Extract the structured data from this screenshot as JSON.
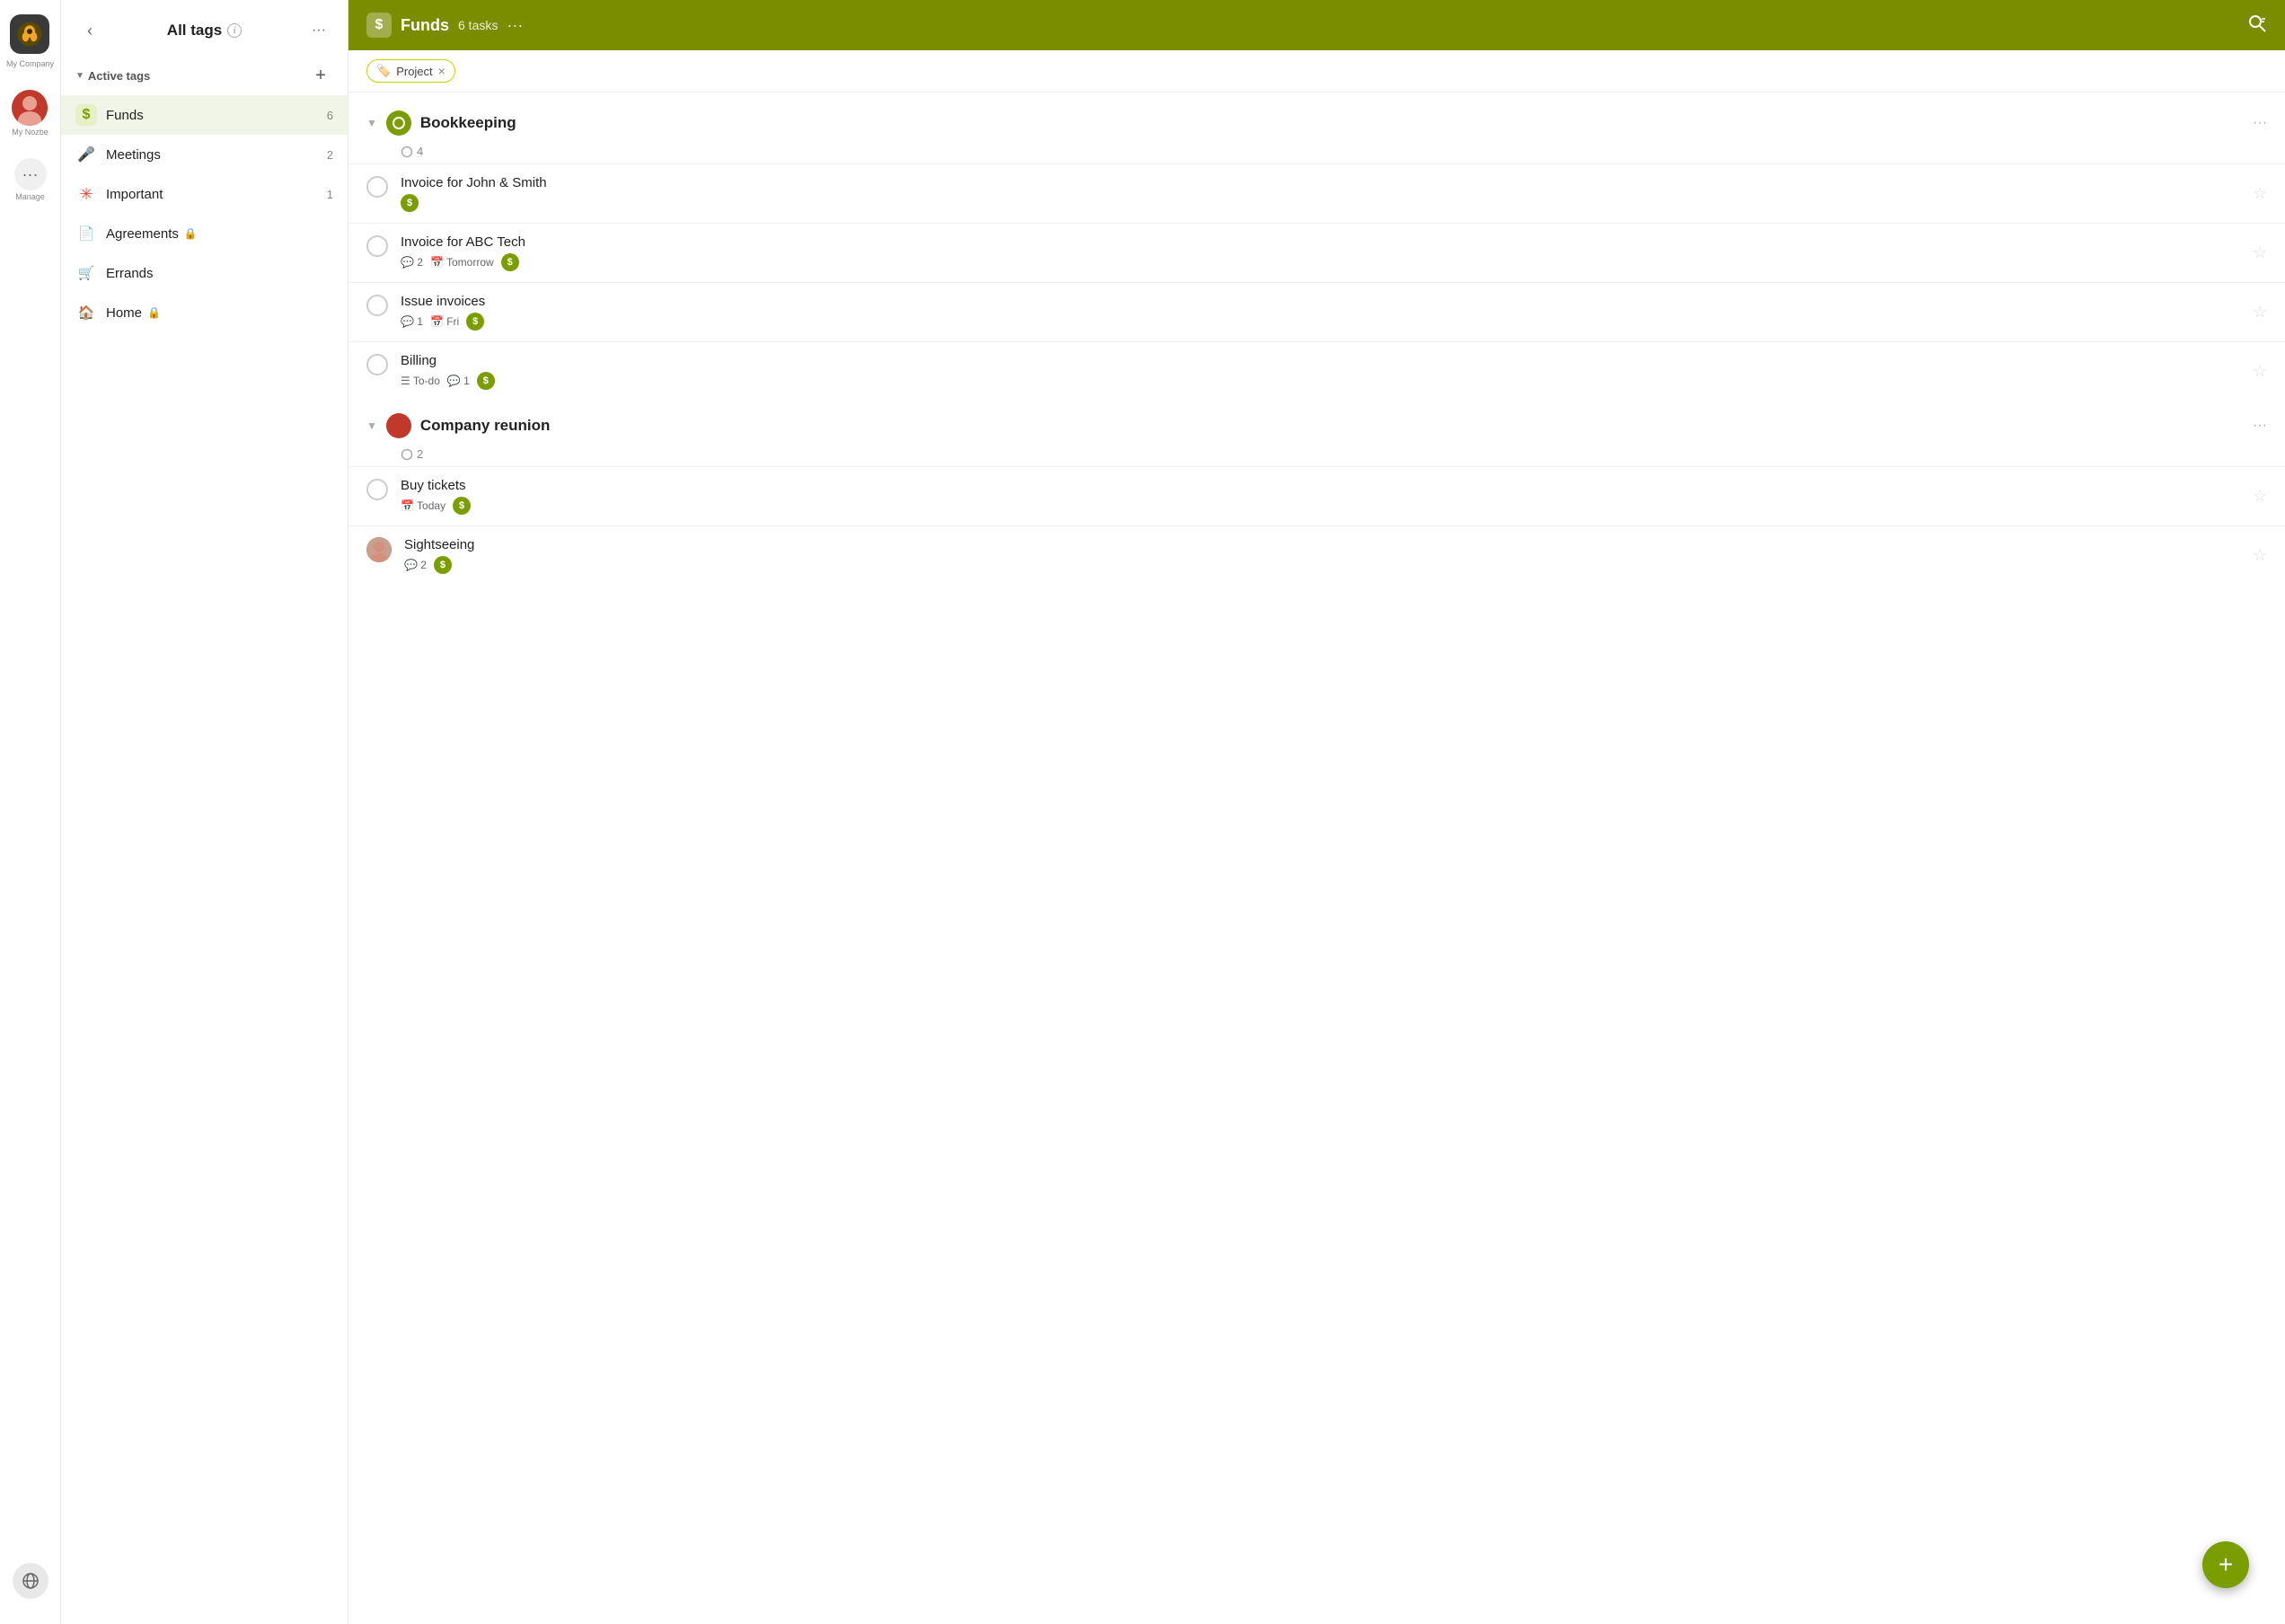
{
  "app": {
    "company": "My Company",
    "user": "My Nozbe",
    "manage": "Manage"
  },
  "sidebar": {
    "back_label": "‹",
    "title": "All tags",
    "more_label": "···",
    "section": {
      "label": "Active tags",
      "add_label": "+"
    },
    "tags": [
      {
        "id": "funds",
        "icon": "$",
        "icon_color": "#7a9e00",
        "name": "Funds",
        "count": 6,
        "active": true
      },
      {
        "id": "meetings",
        "icon": "🎤",
        "name": "Meetings",
        "count": 2,
        "active": false
      },
      {
        "id": "important",
        "icon": "❋",
        "icon_color": "#e74c3c",
        "name": "Important",
        "count": 1,
        "active": false
      },
      {
        "id": "agreements",
        "icon": "📄",
        "name": "Agreements",
        "locked": true,
        "count": null,
        "active": false
      },
      {
        "id": "errands",
        "icon": "🛒",
        "name": "Errands",
        "count": null,
        "active": false
      },
      {
        "id": "home",
        "icon": "🏠",
        "name": "Home",
        "locked": true,
        "count": null,
        "active": false
      }
    ]
  },
  "main": {
    "header": {
      "icon": "$",
      "title": "Funds",
      "task_count": "6 tasks",
      "more_label": "···",
      "search_label": "⌕"
    },
    "filter": {
      "chip_icon": "🏷️",
      "chip_label": "Project",
      "chip_close": "×"
    },
    "projects": [
      {
        "id": "bookkeeping",
        "name": "Bookkeeping",
        "dot_color": "green",
        "task_count": "4",
        "tasks": [
          {
            "id": "t1",
            "name": "Invoice for John & Smith",
            "meta": [
              {
                "type": "s-badge"
              }
            ],
            "has_avatar": false,
            "avatar_src": ""
          },
          {
            "id": "t2",
            "name": "Invoice for ABC Tech",
            "meta": [
              {
                "type": "comment",
                "label": "💬 2"
              },
              {
                "type": "date",
                "label": "📅 Tomorrow"
              },
              {
                "type": "s-badge"
              }
            ],
            "has_avatar": false
          },
          {
            "id": "t3",
            "name": "Issue invoices",
            "meta": [
              {
                "type": "comment",
                "label": "💬 1"
              },
              {
                "type": "date",
                "label": "📅 Fri"
              },
              {
                "type": "s-badge"
              }
            ],
            "has_avatar": false
          },
          {
            "id": "t4",
            "name": "Billing",
            "meta": [
              {
                "type": "list",
                "label": "☰ To-do"
              },
              {
                "type": "comment",
                "label": "💬 1"
              },
              {
                "type": "s-badge"
              }
            ],
            "has_avatar": false
          }
        ]
      },
      {
        "id": "company-reunion",
        "name": "Company reunion",
        "dot_color": "red",
        "task_count": "2",
        "tasks": [
          {
            "id": "t5",
            "name": "Buy tickets",
            "meta": [
              {
                "type": "date",
                "label": "📅 Today"
              },
              {
                "type": "s-badge"
              }
            ],
            "has_avatar": false
          },
          {
            "id": "t6",
            "name": "Sightseeing",
            "meta": [
              {
                "type": "comment",
                "label": "💬 2"
              },
              {
                "type": "s-badge"
              }
            ],
            "has_avatar": true
          }
        ]
      }
    ],
    "fab_label": "+"
  }
}
